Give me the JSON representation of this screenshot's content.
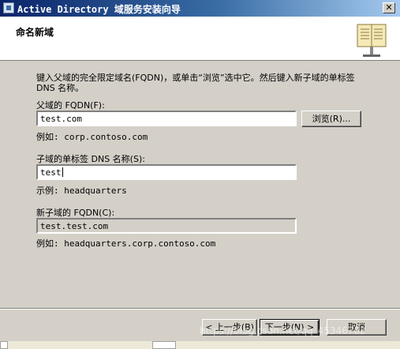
{
  "window": {
    "title": "Active Directory 域服务安装向导",
    "close_glyph": "✕"
  },
  "header": {
    "title": "命名新域",
    "icon": "book-icon"
  },
  "content": {
    "description": "键入父域的完全限定域名(FQDN)，或单击“浏览”选中它。然后键入新子域的单标签 DNS 名称。",
    "parent_fqdn": {
      "label": "父域的 FQDN(F):",
      "value": "test.com",
      "example": "例如: corp.contoso.com",
      "browse_label": "浏览(R)..."
    },
    "child_label": {
      "label": "子域的单标签 DNS 名称(S):",
      "value": "test",
      "example": "示例: headquarters"
    },
    "new_fqdn": {
      "label": "新子域的 FQDN(C):",
      "value": "test.test.com",
      "example": "例如: headquarters.corp.contoso.com"
    }
  },
  "buttons": {
    "back": "< 上一步(B)",
    "next": "下一步(N) >",
    "cancel": "取消"
  },
  "watermark": "https://blog.csdn.net/qq_45346782"
}
